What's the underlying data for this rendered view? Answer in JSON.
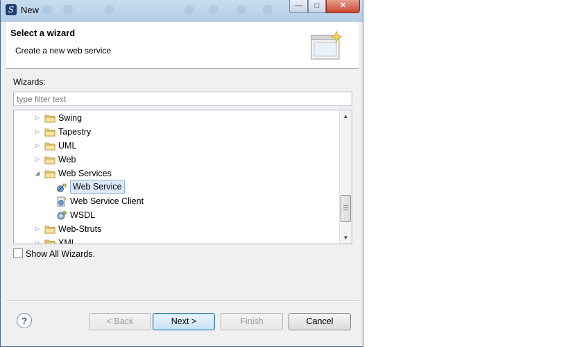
{
  "window": {
    "title": "New",
    "app_icon": "eclipse-icon"
  },
  "banner": {
    "heading": "Select a wizard",
    "description": "Create a new web service",
    "graphic": "new-wizard-icon"
  },
  "wizards_label": "Wizards:",
  "filter": {
    "value": "",
    "placeholder": "type filter text"
  },
  "tree": {
    "items": [
      {
        "label": "Swing",
        "icon": "folder-icon",
        "expanded": false,
        "level": 0
      },
      {
        "label": "Tapestry",
        "icon": "folder-icon",
        "expanded": false,
        "level": 0
      },
      {
        "label": "UML",
        "icon": "folder-icon",
        "expanded": false,
        "level": 0
      },
      {
        "label": "Web",
        "icon": "folder-icon",
        "expanded": false,
        "level": 0
      },
      {
        "label": "Web Services",
        "icon": "folder-icon",
        "expanded": true,
        "level": 0
      },
      {
        "label": "Web Service",
        "icon": "web-service-icon",
        "level": 1,
        "selected": true
      },
      {
        "label": "Web Service Client",
        "icon": "web-service-client-icon",
        "level": 1
      },
      {
        "label": "WSDL",
        "icon": "wsdl-icon",
        "level": 1
      },
      {
        "label": "Web-Struts",
        "icon": "folder-icon",
        "expanded": false,
        "level": 0
      },
      {
        "label": "XML",
        "icon": "folder-icon",
        "expanded": false,
        "level": 0
      }
    ]
  },
  "show_all": {
    "label": "Show All Wizards.",
    "checked": false
  },
  "buttons": {
    "back": "< Back",
    "next": "Next >",
    "finish": "Finish",
    "cancel": "Cancel"
  },
  "colors": {
    "selection": "#dce9f9",
    "folder": "#e8c15a",
    "title_bar": "#c9dcf0"
  }
}
